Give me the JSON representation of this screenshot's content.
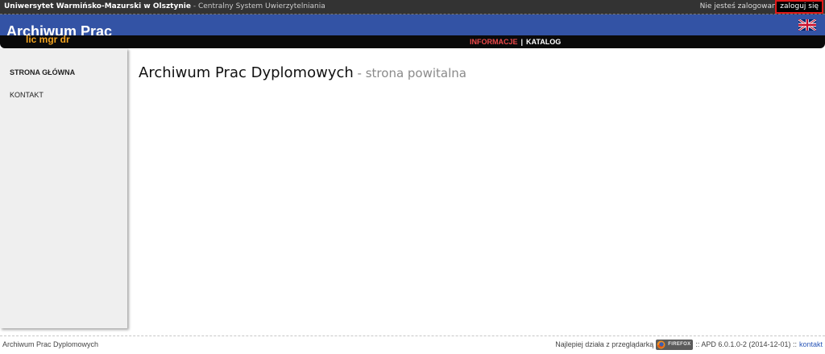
{
  "topbar": {
    "university": "Uniwersytet Warmińsko-Mazurski w Olsztynie",
    "separator": " - ",
    "system": "Centralny System Uwierzytelniania",
    "status": "Nie jesteś zalogowany",
    "login_label": "zaloguj się",
    "login_border_color": "#e01919"
  },
  "header": {
    "title": "Archiwum Prac",
    "subtitle": "lic mgr dr",
    "bg_color": "#3353a5",
    "language_icon": "uk-flag-icon"
  },
  "nav": {
    "items": [
      {
        "label": "INFORMACJE",
        "active": true
      },
      {
        "label": "KATALOG",
        "active": false
      }
    ],
    "separator": "|",
    "active_color": "#f04a4a"
  },
  "sidebar": {
    "items": [
      {
        "label": "STRONA GŁÓWNA",
        "active": true
      },
      {
        "label": "KONTAKT",
        "active": false
      }
    ]
  },
  "main": {
    "title": "Archiwum Prac Dyplomowych",
    "subtitle": " - strona powitalna"
  },
  "footer": {
    "left": "Archiwum Prac Dyplomowych",
    "browser_text": "Najlepiej działa z przeglądarką",
    "browser_badge": "FIREFOX",
    "browser_icon": "firefox-icon",
    "version": ":: APD 6.0.1.0-2 (2014-12-01) ::",
    "contact_label": "kontakt",
    "link_color": "#2a56b8"
  }
}
